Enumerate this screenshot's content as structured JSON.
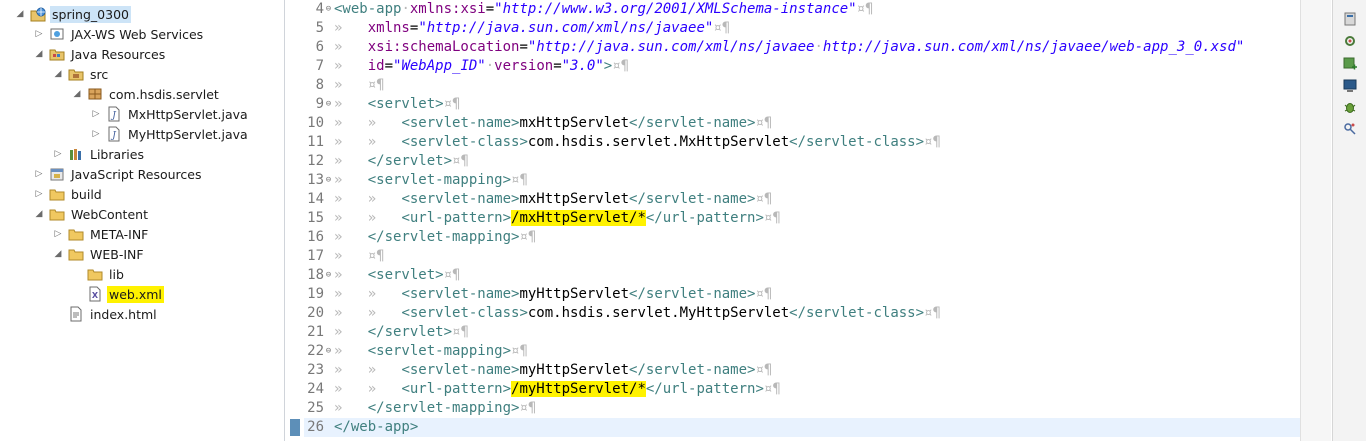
{
  "explorer": {
    "items": [
      {
        "label": "spring_0300",
        "indent": 0,
        "arrow": "open",
        "icon": "web-project-icon",
        "highlight": false,
        "selected": true
      },
      {
        "label": "JAX-WS Web Services",
        "indent": 1,
        "arrow": "closed",
        "icon": "webservice-icon",
        "highlight": false
      },
      {
        "label": "Java Resources",
        "indent": 1,
        "arrow": "open",
        "icon": "java-resources-icon",
        "highlight": false
      },
      {
        "label": "src",
        "indent": 2,
        "arrow": "open",
        "icon": "source-folder-icon",
        "highlight": false
      },
      {
        "label": "com.hsdis.servlet",
        "indent": 3,
        "arrow": "open",
        "icon": "package-icon",
        "highlight": false
      },
      {
        "label": "MxHttpServlet.java",
        "indent": 4,
        "arrow": "closed",
        "icon": "java-file-icon",
        "highlight": false
      },
      {
        "label": "MyHttpServlet.java",
        "indent": 4,
        "arrow": "closed",
        "icon": "java-file-icon",
        "highlight": false
      },
      {
        "label": "Libraries",
        "indent": 2,
        "arrow": "closed",
        "icon": "libraries-icon",
        "highlight": false
      },
      {
        "label": "JavaScript Resources",
        "indent": 1,
        "arrow": "closed",
        "icon": "javascript-resources-icon",
        "highlight": false
      },
      {
        "label": "build",
        "indent": 1,
        "arrow": "closed",
        "icon": "folder-icon",
        "highlight": false
      },
      {
        "label": "WebContent",
        "indent": 1,
        "arrow": "open",
        "icon": "folder-icon",
        "highlight": false
      },
      {
        "label": "META-INF",
        "indent": 2,
        "arrow": "closed",
        "icon": "folder-icon",
        "highlight": false
      },
      {
        "label": "WEB-INF",
        "indent": 2,
        "arrow": "open",
        "icon": "folder-icon",
        "highlight": false
      },
      {
        "label": "lib",
        "indent": 3,
        "arrow": "none",
        "icon": "folder-icon",
        "highlight": false
      },
      {
        "label": "web.xml",
        "indent": 3,
        "arrow": "none",
        "icon": "xml-file-icon",
        "highlight": true
      },
      {
        "label": "index.html",
        "indent": 2,
        "arrow": "none",
        "icon": "html-file-icon",
        "highlight": false
      }
    ]
  },
  "editor": {
    "current_line": 26,
    "lines": [
      {
        "n": "4",
        "fold": "expanded",
        "ind": 0,
        "tokens": [
          [
            "tag",
            "<web-app"
          ],
          [
            "ws",
            "·"
          ],
          [
            "attr",
            "xmlns:xsi"
          ],
          [
            "txt",
            "="
          ],
          [
            "val",
            "\"http://www.w3.org/2001/XMLSchema-instance\""
          ],
          [
            "ws",
            "¤¶"
          ]
        ]
      },
      {
        "n": "5",
        "fold": "",
        "ind": 1,
        "tokens": [
          [
            "attr",
            "xmlns"
          ],
          [
            "txt",
            "="
          ],
          [
            "val",
            "\"http://java.sun.com/xml/ns/javaee\""
          ],
          [
            "ws",
            "¤¶"
          ]
        ]
      },
      {
        "n": "6",
        "fold": "",
        "ind": 1,
        "tokens": [
          [
            "attr",
            "xsi:schemaLocation"
          ],
          [
            "txt",
            "="
          ],
          [
            "val",
            "\"http://java.sun.com/xml/ns/javaee"
          ],
          [
            "ws",
            "·"
          ],
          [
            "val",
            "http://java.sun.com/xml/ns/javaee/web-app_3_0.xsd\""
          ]
        ]
      },
      {
        "n": "7",
        "fold": "",
        "ind": 1,
        "tokens": [
          [
            "attr",
            "id"
          ],
          [
            "txt",
            "="
          ],
          [
            "val",
            "\"WebApp_ID\""
          ],
          [
            "ws",
            "·"
          ],
          [
            "attr",
            "version"
          ],
          [
            "txt",
            "="
          ],
          [
            "val",
            "\"3.0\""
          ],
          [
            "tag",
            ">"
          ],
          [
            "ws",
            "¤¶"
          ]
        ]
      },
      {
        "n": "8",
        "fold": "",
        "ind": 1,
        "tokens": [
          [
            "ws",
            "¤¶"
          ]
        ]
      },
      {
        "n": "9",
        "fold": "expanded",
        "ind": 1,
        "tokens": [
          [
            "tag",
            "<servlet>"
          ],
          [
            "ws",
            "¤¶"
          ]
        ]
      },
      {
        "n": "10",
        "fold": "",
        "ind": 2,
        "tokens": [
          [
            "tag",
            "<servlet-name>"
          ],
          [
            "txt",
            "mxHttpServlet"
          ],
          [
            "tag",
            "</servlet-name>"
          ],
          [
            "ws",
            "¤¶"
          ]
        ]
      },
      {
        "n": "11",
        "fold": "",
        "ind": 2,
        "tokens": [
          [
            "tag",
            "<servlet-class>"
          ],
          [
            "txt",
            "com.hsdis.servlet.MxHttpServlet"
          ],
          [
            "tag",
            "</servlet-class>"
          ],
          [
            "ws",
            "¤¶"
          ]
        ]
      },
      {
        "n": "12",
        "fold": "",
        "ind": 1,
        "tokens": [
          [
            "tag",
            "</servlet>"
          ],
          [
            "ws",
            "¤¶"
          ]
        ]
      },
      {
        "n": "13",
        "fold": "expanded",
        "ind": 1,
        "tokens": [
          [
            "tag",
            "<servlet-mapping>"
          ],
          [
            "ws",
            "¤¶"
          ]
        ]
      },
      {
        "n": "14",
        "fold": "",
        "ind": 2,
        "tokens": [
          [
            "tag",
            "<servlet-name>"
          ],
          [
            "txt",
            "mxHttpServlet"
          ],
          [
            "tag",
            "</servlet-name>"
          ],
          [
            "ws",
            "¤¶"
          ]
        ]
      },
      {
        "n": "15",
        "fold": "",
        "ind": 2,
        "tokens": [
          [
            "tag",
            "<url-pattern>"
          ],
          [
            "mark",
            "/mxHttpServlet/*"
          ],
          [
            "tag",
            "</url-pattern>"
          ],
          [
            "ws",
            "¤¶"
          ]
        ]
      },
      {
        "n": "16",
        "fold": "",
        "ind": 1,
        "tokens": [
          [
            "tag",
            "</servlet-mapping>"
          ],
          [
            "ws",
            "¤¶"
          ]
        ]
      },
      {
        "n": "17",
        "fold": "",
        "ind": 1,
        "tokens": [
          [
            "ws",
            "¤¶"
          ]
        ]
      },
      {
        "n": "18",
        "fold": "expanded",
        "ind": 1,
        "tokens": [
          [
            "tag",
            "<servlet>"
          ],
          [
            "ws",
            "¤¶"
          ]
        ]
      },
      {
        "n": "19",
        "fold": "",
        "ind": 2,
        "tokens": [
          [
            "tag",
            "<servlet-name>"
          ],
          [
            "txt",
            "myHttpServlet"
          ],
          [
            "tag",
            "</servlet-name>"
          ],
          [
            "ws",
            "¤¶"
          ]
        ]
      },
      {
        "n": "20",
        "fold": "",
        "ind": 2,
        "tokens": [
          [
            "tag",
            "<servlet-class>"
          ],
          [
            "txt",
            "com.hsdis.servlet.MyHttpServlet"
          ],
          [
            "tag",
            "</servlet-class>"
          ],
          [
            "ws",
            "¤¶"
          ]
        ]
      },
      {
        "n": "21",
        "fold": "",
        "ind": 1,
        "tokens": [
          [
            "tag",
            "</servlet>"
          ],
          [
            "ws",
            "¤¶"
          ]
        ]
      },
      {
        "n": "22",
        "fold": "expanded",
        "ind": 1,
        "tokens": [
          [
            "tag",
            "<servlet-mapping>"
          ],
          [
            "ws",
            "¤¶"
          ]
        ]
      },
      {
        "n": "23",
        "fold": "",
        "ind": 2,
        "tokens": [
          [
            "tag",
            "<servlet-name>"
          ],
          [
            "txt",
            "myHttpServlet"
          ],
          [
            "tag",
            "</servlet-name>"
          ],
          [
            "ws",
            "¤¶"
          ]
        ]
      },
      {
        "n": "24",
        "fold": "",
        "ind": 2,
        "tokens": [
          [
            "tag",
            "<url-pattern>"
          ],
          [
            "mark",
            "/myHttpServlet/*"
          ],
          [
            "tag",
            "</url-pattern>"
          ],
          [
            "ws",
            "¤¶"
          ]
        ]
      },
      {
        "n": "25",
        "fold": "",
        "ind": 1,
        "tokens": [
          [
            "tag",
            "</servlet-mapping>"
          ],
          [
            "ws",
            "¤¶"
          ]
        ]
      },
      {
        "n": "26",
        "fold": "",
        "ind": 0,
        "tokens": [
          [
            "tag",
            "</web-app>"
          ]
        ]
      }
    ]
  },
  "toolbar": {
    "buttons": [
      "server-icon",
      "debug-gear-icon",
      "new-server-icon",
      "console-icon",
      "bug-icon",
      "profile-icon"
    ]
  },
  "colors": {
    "highlight": "#fff200",
    "tag": "#3f7f7f",
    "attr": "#7f007f",
    "value": "#2a00ff",
    "selection": "#cde4f7"
  }
}
